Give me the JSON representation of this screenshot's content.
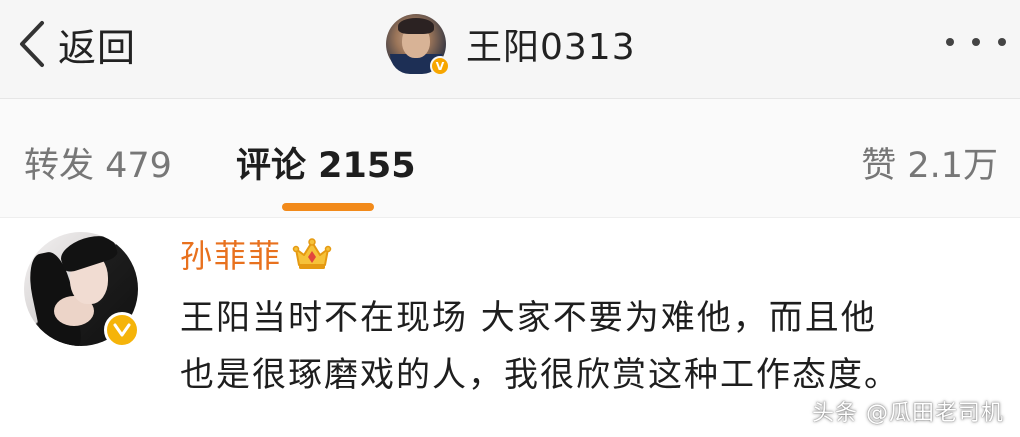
{
  "header": {
    "back_label": "返回",
    "title": "王阳0313"
  },
  "tabs": [
    {
      "label": "转发 479",
      "active": false
    },
    {
      "label": "评论 2155",
      "active": true
    },
    {
      "label": "赞 2.1万",
      "active": false
    }
  ],
  "comment": {
    "author": "孙菲菲",
    "lines": [
      "王阳当时不在现场 大家不要为难他，而且他",
      "也是很琢磨戏的人，我很欣赏这种工作态度。"
    ]
  },
  "watermark": "头条 @瓜田老司机",
  "colors": {
    "accent_orange": "#f28a1a",
    "name_orange": "#e8711e",
    "verified_gold": "#f5b40a"
  },
  "icons": {
    "back": "chevron-left-icon",
    "more": "more-dots-icon",
    "verified": "verified-v-icon",
    "crown": "crown-icon"
  }
}
